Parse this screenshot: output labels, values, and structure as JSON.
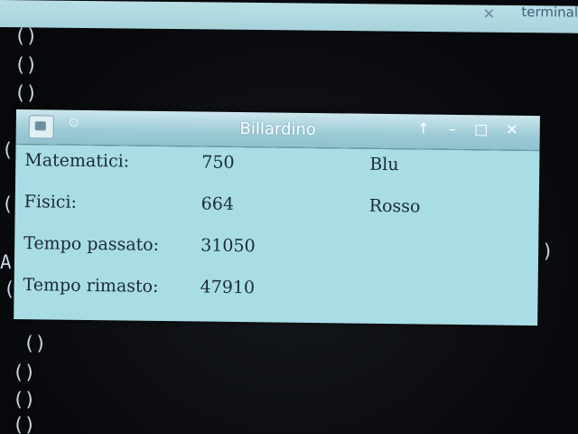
{
  "background": {
    "tab_label": "terminal",
    "terminal_left_text": [
      "()",
      "()",
      "()",
      "(",
      "(",
      "A",
      "(",
      "()",
      "()",
      "()",
      "()"
    ],
    "terminal_right_text": [
      ")"
    ]
  },
  "window": {
    "title": "Billardino",
    "buttons": {
      "up": "↑",
      "minimize": "–",
      "maximize": "□",
      "close": "✕"
    },
    "rows": [
      {
        "label": "Matematici:",
        "value": "750",
        "extra": "Blu"
      },
      {
        "label": "Fisici:",
        "value": "664",
        "extra": "Rosso"
      },
      {
        "label": "Tempo passato:",
        "value": "31050",
        "extra": ""
      },
      {
        "label": "Tempo rimasto:",
        "value": "47910",
        "extra": ""
      }
    ]
  },
  "colors": {
    "window_body": "#a9dde6",
    "titlebar": "#9ccbd6",
    "terminal_bg": "#0a0c10"
  }
}
